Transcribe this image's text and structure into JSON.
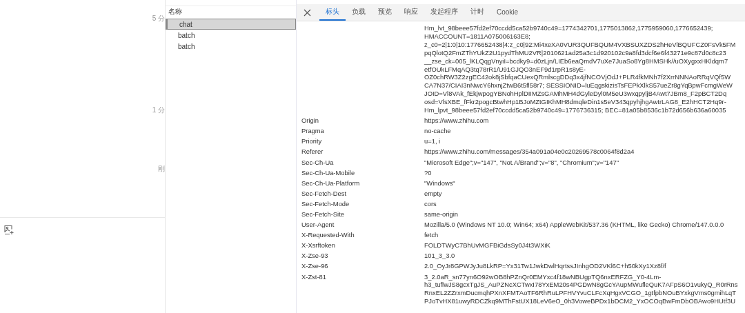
{
  "timeline": {
    "labels": [
      "5 分",
      "1 分",
      "刚"
    ]
  },
  "requests": {
    "header": "名称",
    "items": [
      {
        "name": "chat",
        "selected": true
      },
      {
        "name": "batch",
        "selected": false
      },
      {
        "name": "batch",
        "selected": false
      }
    ]
  },
  "details": {
    "tabs": [
      {
        "label": "标头",
        "selected": true
      },
      {
        "label": "负载",
        "selected": false
      },
      {
        "label": "预览",
        "selected": false
      },
      {
        "label": "响应",
        "selected": false
      },
      {
        "label": "发起程序",
        "selected": false
      },
      {
        "label": "计时",
        "selected": false
      },
      {
        "label": "Cookie",
        "selected": false
      }
    ],
    "headers": [
      {
        "lines": [
          "Hm_lvt_98beee57fd2ef70ccdd5ca52b9740c49=1774342701,1775013862,1775959060,1776652439;",
          "HMACCOUNT=1811A075006163E8;",
          "z_c0=2|1:0|10:1776652438|4:z_c0|92:Mi4xeXA0VUR3QUFBQUM4VXBSUXZDS2hHeVlBQUFCZ0FsVk5FM",
          "pqQlotQ2FmZThYUkZ2U1pydThMU2VR|2010621ad25a3c1d920102c9a8fd3dcf6e6f43271e9c87d0c8c23",
          "__zse_ck=005_lKLQqgVnyiI=bcdky9=d0zLjn/LIEb6eaQmdV7uXe7JuaSo8Yg8HMSHk//uOXygxxHKldqm7",
          "etfOUkLFMqAQ3tq78rR1/U91GJQO3nEF9d1rpR1s8yE-",
          "OZ0chRW3Z2zgEC42ok8jSbfqaCUexQRmlscgDDq3x4jfNCOVjOdJ+PLR4fkMNh7f2XrrNNNAoRRqVQf5W",
          "CA7N37/CIAI3nNwcY6hxnjZtwB6t5fl58r7; SESSIONID=luEqgskizisTsFEPkXlkS57ueZr8gYqBpwFcmgWeW",
          "JOID=Vl8VAk_fEkjwpogYBNohHplDIIMZsGAMhMH4dGyleDyl0M5eU3wxqpyljB4Awt7JBm8_F2pBCT2Dq",
          "osd=VlsXBE_fFkr2pogcBtwhHp1BJoMZtGIKhMH8dmqleDin1s5eV343qpyhjhgAwtrLAG8_E2hHCT2Hq9r-",
          "Hm_lpvt_98beee57fd2ef70ccdd5ca52b9740c49=1776736315; BEC=81a05b8536c1b72d656b636a60035"
        ]
      },
      {
        "name": "Origin",
        "lines": [
          "https://www.zhihu.com"
        ]
      },
      {
        "name": "Pragma",
        "lines": [
          "no-cache"
        ]
      },
      {
        "name": "Priority",
        "lines": [
          "u=1, i"
        ]
      },
      {
        "name": "Referer",
        "lines": [
          "https://www.zhihu.com/messages/354a091a04e0c20269578c0064f8d2a4"
        ]
      },
      {
        "name": "Sec-Ch-Ua",
        "lines": [
          "\"Microsoft Edge\";v=\"147\", \"Not.A/Brand\";v=\"8\", \"Chromium\";v=\"147\""
        ]
      },
      {
        "name": "Sec-Ch-Ua-Mobile",
        "lines": [
          "?0"
        ]
      },
      {
        "name": "Sec-Ch-Ua-Platform",
        "lines": [
          "\"Windows\""
        ]
      },
      {
        "name": "Sec-Fetch-Dest",
        "lines": [
          "empty"
        ]
      },
      {
        "name": "Sec-Fetch-Mode",
        "lines": [
          "cors"
        ]
      },
      {
        "name": "Sec-Fetch-Site",
        "lines": [
          "same-origin"
        ]
      },
      {
        "name": "User-Agent",
        "lines": [
          "Mozilla/5.0 (Windows NT 10.0; Win64; x64) AppleWebKit/537.36 (KHTML, like Gecko) Chrome/147.0.0.0"
        ]
      },
      {
        "name": "X-Requested-With",
        "lines": [
          "fetch"
        ]
      },
      {
        "name": "X-Xsrftoken",
        "lines": [
          "FOLDTWyC7BhUvMGFBiGdsSy0J4t3WXiK"
        ]
      },
      {
        "name": "X-Zse-93",
        "lines": [
          "101_3_3.0"
        ]
      },
      {
        "name": "X-Zse-96",
        "lines": [
          "2.0_OyJr8GPWJyJu8LkRP=Yx31Tw1JwkDwlHqrtssJInhgOD2VKl6C+h50kXy1Xz8f/f"
        ]
      },
      {
        "name": "X-Zst-81",
        "lines": [
          "3_2.0aR_sn77yn6O92wOB8hPZnQr0EMYxc4f18wNBUgpTQ6nxERFZG_Y0-4Lm-",
          "h3_tuflwJS8gcxTgJS_AuPZNcXCTwxI78YxEM20s4PGDwN8gGcYAupMWufleQuK7AFpS6O1vukyQ_R0rRns",
          "RnxEL2ZZrxmDucmqhPXnXFMTAoTF6RhRuLPFHVYvuCLFcXqHgxVCGO_1gtfpbNOuBYxkgVms0gmihLqT",
          "PJoTvHX81uwyRDCZkq9MThFstUX18LeV6eO_0h3VoweBPDx1bDCM2_YxOCOqBwFmDbOBAwo9HUtf3U"
        ]
      }
    ]
  }
}
